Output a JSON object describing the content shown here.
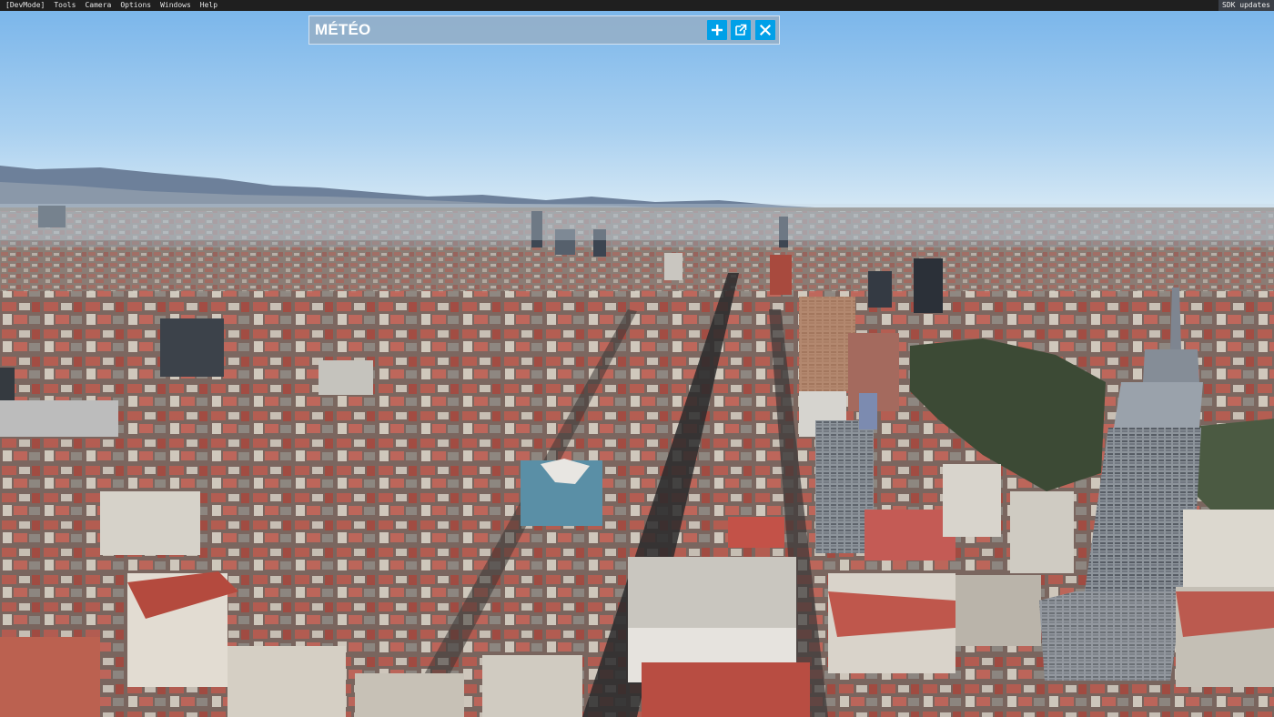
{
  "menubar": {
    "items": [
      "[DevMode]",
      "Tools",
      "Camera",
      "Options",
      "Windows",
      "Help"
    ],
    "sdk_updates": "SDK updates"
  },
  "panel": {
    "title": "MÉTÉO",
    "add_icon": "plus-icon",
    "popout_icon": "external-window-icon",
    "close_icon": "close-icon",
    "button_color": "#00a0e8"
  },
  "scene": {
    "description_icon": "aerial-city-view",
    "sky_top": "#7db8ec",
    "sky_horizon": "#dfeef7",
    "mountains": "#5d7390",
    "city_roofs": "#b55a4e"
  }
}
